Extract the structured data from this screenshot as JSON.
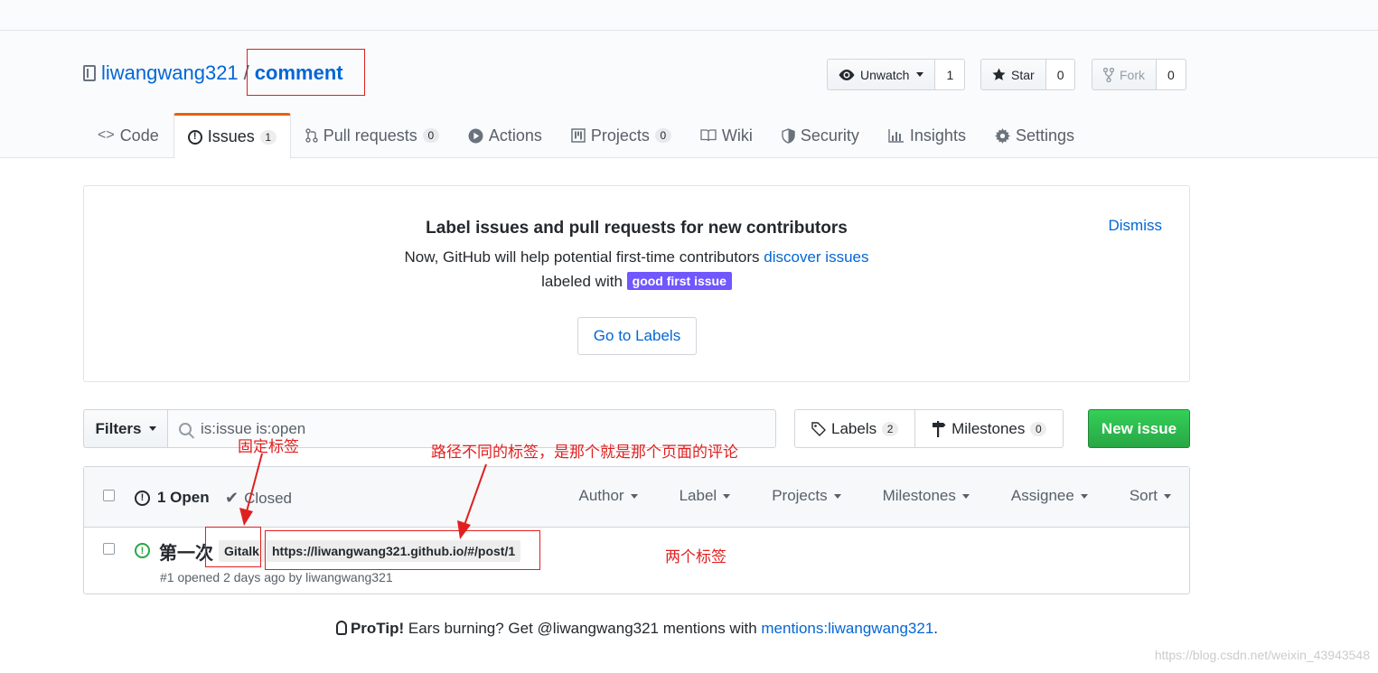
{
  "repo": {
    "owner": "liwangwang321",
    "separator": "/",
    "name": "comment"
  },
  "actions": {
    "watch": {
      "label": "Unwatch",
      "count": "1"
    },
    "star": {
      "label": "Star",
      "count": "0"
    },
    "fork": {
      "label": "Fork",
      "count": "0"
    }
  },
  "tabs": [
    {
      "label": "Code",
      "counter": ""
    },
    {
      "label": "Issues",
      "counter": "1"
    },
    {
      "label": "Pull requests",
      "counter": "0"
    },
    {
      "label": "Actions",
      "counter": ""
    },
    {
      "label": "Projects",
      "counter": "0"
    },
    {
      "label": "Wiki",
      "counter": ""
    },
    {
      "label": "Security",
      "counter": ""
    },
    {
      "label": "Insights",
      "counter": ""
    },
    {
      "label": "Settings",
      "counter": ""
    }
  ],
  "banner": {
    "title": "Label issues and pull requests for new contributors",
    "line1_text": "Now, GitHub will help potential first-time contributors",
    "line1_link": "discover issues",
    "line2_text": "labeled with",
    "label": "good first issue",
    "dismiss": "Dismiss",
    "button": "Go to Labels"
  },
  "filters": {
    "button": "Filters",
    "query": "is:issue is:open"
  },
  "labels_btn": {
    "label": "Labels",
    "count": "2"
  },
  "milestones_btn": {
    "label": "Milestones",
    "count": "0"
  },
  "new_issue": "New issue",
  "issues_header": {
    "open": "1 Open",
    "closed": "Closed",
    "menus": [
      "Author",
      "Label",
      "Projects",
      "Milestones",
      "Assignee",
      "Sort"
    ]
  },
  "issue": {
    "title": "第一次",
    "labels": [
      "Gitalk",
      "https://liwangwang321.github.io/#/post/1"
    ],
    "meta": "#1 opened 2 days ago by liwangwang321"
  },
  "annotations": {
    "fixed_label": "固定标签",
    "path_label": "路径不同的标签，是那个就是那个页面的评论",
    "two_labels": "两个标签"
  },
  "protip": {
    "strong": "ProTip!",
    "text": " Ears burning? Get @liwangwang321 mentions with ",
    "link": "mentions:liwangwang321",
    "end": "."
  },
  "watermark": "https://blog.csdn.net/weixin_43943548",
  "colors": {
    "accent": "#0366d6",
    "green": "#28a745",
    "good_first_issue": "#7057ff",
    "annotation": "#e02020",
    "tab_highlight": "#e36209"
  }
}
